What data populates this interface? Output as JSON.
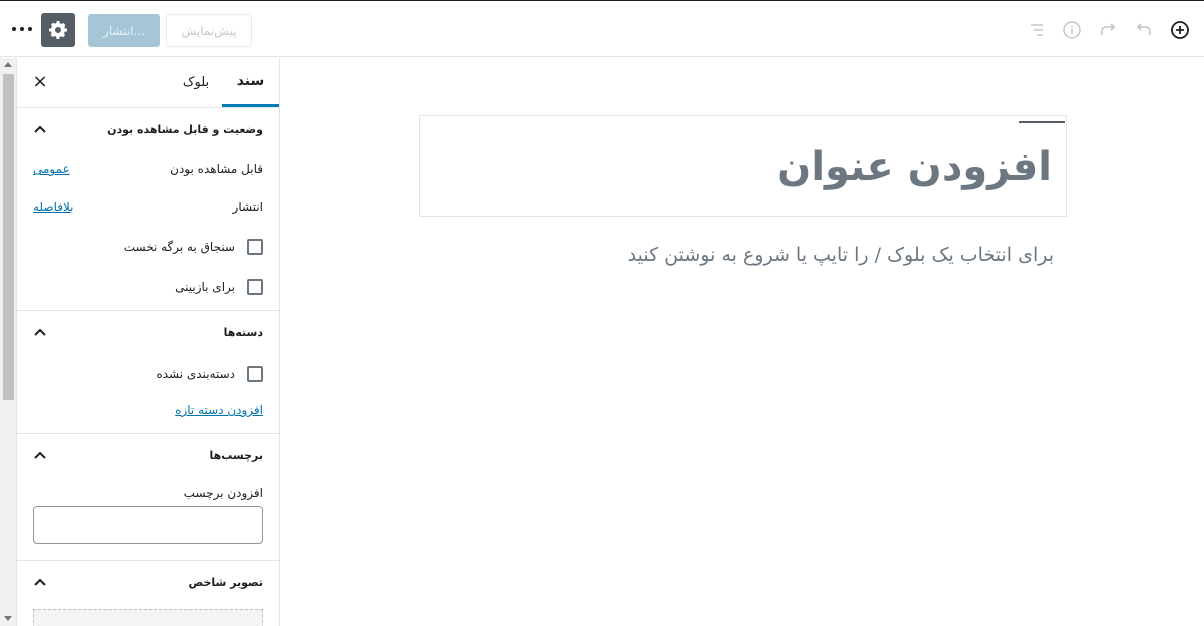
{
  "toolbar": {
    "publish_label": "انتشار...",
    "preview_label": "پیش‌نمایش",
    "icons": [
      "more-vertical-icon",
      "gear-icon",
      "list-view-icon",
      "info-icon",
      "redo-icon",
      "undo-icon",
      "add-block-icon"
    ]
  },
  "sidebar": {
    "tabs": {
      "document": "سند",
      "block": "بلوک"
    },
    "close_symbol": "×",
    "status_panel": {
      "title": "وضعیت و قابل مشاهده بودن",
      "visibility_label": "قابل مشاهده بودن",
      "visibility_value": "عمومی",
      "publish_label": "انتشار",
      "publish_value": "بلافاصله",
      "sticky_label": "سنجاق به برگه نخست",
      "pending_label": "برای بازبینی"
    },
    "categories_panel": {
      "title": "دسته‌ها",
      "uncategorized_label": "دسته‌بندی نشده",
      "add_new_link": "افزودن دسته تازه"
    },
    "tags_panel": {
      "title": "برچسب‌ها",
      "add_tag_label": "افزودن برچسب",
      "input_value": ""
    },
    "featured_image_panel": {
      "title": "تصویر شاخص"
    }
  },
  "editor": {
    "title_placeholder": "افزودن عنوان",
    "block_placeholder": "برای انتخاب یک بلوک / را تایپ یا شروع به نوشتن کنید"
  },
  "colors": {
    "accent": "#007cba",
    "link": "#0073aa",
    "publish_disabled": "#a6c6d8",
    "settings_bg": "#555d66"
  }
}
